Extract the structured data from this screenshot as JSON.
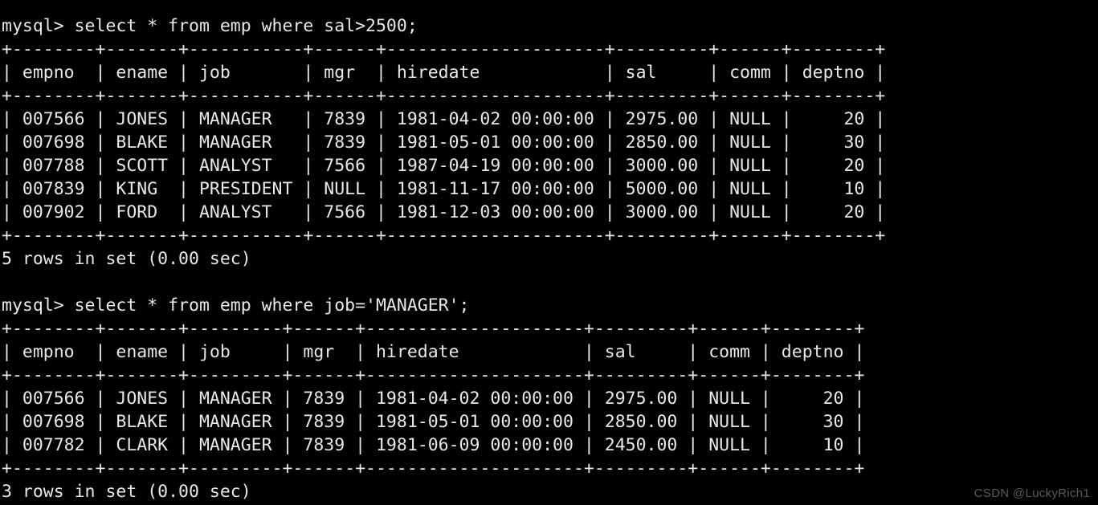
{
  "terminal": {
    "prompt": "mysql>",
    "background_color": "#000000",
    "text_color": "#e8e8e8",
    "blocks": [
      {
        "command_line": "mysql> select * from emp where sal>2500;",
        "query": "select * from emp where sal>2500;",
        "separator": "+--------+-------+-----------+------+---------------------+---------+------+--------+",
        "header_row": "| empno  | ename | job       | mgr  | hiredate            | sal     | comm | deptno |",
        "columns": [
          "empno",
          "ename",
          "job",
          "mgr",
          "hiredate",
          "sal",
          "comm",
          "deptno"
        ],
        "rows": [
          "| 007566 | JONES | MANAGER   | 7839 | 1981-04-02 00:00:00 | 2975.00 | NULL |     20 |",
          "| 007698 | BLAKE | MANAGER   | 7839 | 1981-05-01 00:00:00 | 2850.00 | NULL |     30 |",
          "| 007788 | SCOTT | ANALYST   | 7566 | 1987-04-19 00:00:00 | 3000.00 | NULL |     20 |",
          "| 007839 | KING  | PRESIDENT | NULL | 1981-11-17 00:00:00 | 5000.00 | NULL |     10 |",
          "| 007902 | FORD  | ANALYST   | 7566 | 1981-12-03 00:00:00 | 3000.00 | NULL |     20 |"
        ],
        "row_values": [
          {
            "empno": "007566",
            "ename": "JONES",
            "job": "MANAGER",
            "mgr": "7839",
            "hiredate": "1981-04-02 00:00:00",
            "sal": "2975.00",
            "comm": "NULL",
            "deptno": "20"
          },
          {
            "empno": "007698",
            "ename": "BLAKE",
            "job": "MANAGER",
            "mgr": "7839",
            "hiredate": "1981-05-01 00:00:00",
            "sal": "2850.00",
            "comm": "NULL",
            "deptno": "30"
          },
          {
            "empno": "007788",
            "ename": "SCOTT",
            "job": "ANALYST",
            "mgr": "7566",
            "hiredate": "1987-04-19 00:00:00",
            "sal": "3000.00",
            "comm": "NULL",
            "deptno": "20"
          },
          {
            "empno": "007839",
            "ename": "KING",
            "job": "PRESIDENT",
            "mgr": "NULL",
            "hiredate": "1981-11-17 00:00:00",
            "sal": "5000.00",
            "comm": "NULL",
            "deptno": "10"
          },
          {
            "empno": "007902",
            "ename": "FORD",
            "job": "ANALYST",
            "mgr": "7566",
            "hiredate": "1981-12-03 00:00:00",
            "sal": "3000.00",
            "comm": "NULL",
            "deptno": "20"
          }
        ],
        "status": "5 rows in set (0.00 sec)"
      },
      {
        "command_line": "mysql> select * from emp where job='MANAGER';",
        "query": "select * from emp where job='MANAGER';",
        "separator": "+--------+-------+---------+------+---------------------+---------+------+--------+",
        "header_row": "| empno  | ename | job     | mgr  | hiredate            | sal     | comm | deptno |",
        "columns": [
          "empno",
          "ename",
          "job",
          "mgr",
          "hiredate",
          "sal",
          "comm",
          "deptno"
        ],
        "rows": [
          "| 007566 | JONES | MANAGER | 7839 | 1981-04-02 00:00:00 | 2975.00 | NULL |     20 |",
          "| 007698 | BLAKE | MANAGER | 7839 | 1981-05-01 00:00:00 | 2850.00 | NULL |     30 |",
          "| 007782 | CLARK | MANAGER | 7839 | 1981-06-09 00:00:00 | 2450.00 | NULL |     10 |"
        ],
        "row_values": [
          {
            "empno": "007566",
            "ename": "JONES",
            "job": "MANAGER",
            "mgr": "7839",
            "hiredate": "1981-04-02 00:00:00",
            "sal": "2975.00",
            "comm": "NULL",
            "deptno": "20"
          },
          {
            "empno": "007698",
            "ename": "BLAKE",
            "job": "MANAGER",
            "mgr": "7839",
            "hiredate": "1981-05-01 00:00:00",
            "sal": "2850.00",
            "comm": "NULL",
            "deptno": "30"
          },
          {
            "empno": "007782",
            "ename": "CLARK",
            "job": "MANAGER",
            "mgr": "7839",
            "hiredate": "1981-06-09 00:00:00",
            "sal": "2450.00",
            "comm": "NULL",
            "deptno": "10"
          }
        ],
        "status": "3 rows in set (0.00 sec)"
      }
    ]
  },
  "watermark": {
    "text": "CSDN @LuckyRich1",
    "color": "#5a5a5a"
  }
}
